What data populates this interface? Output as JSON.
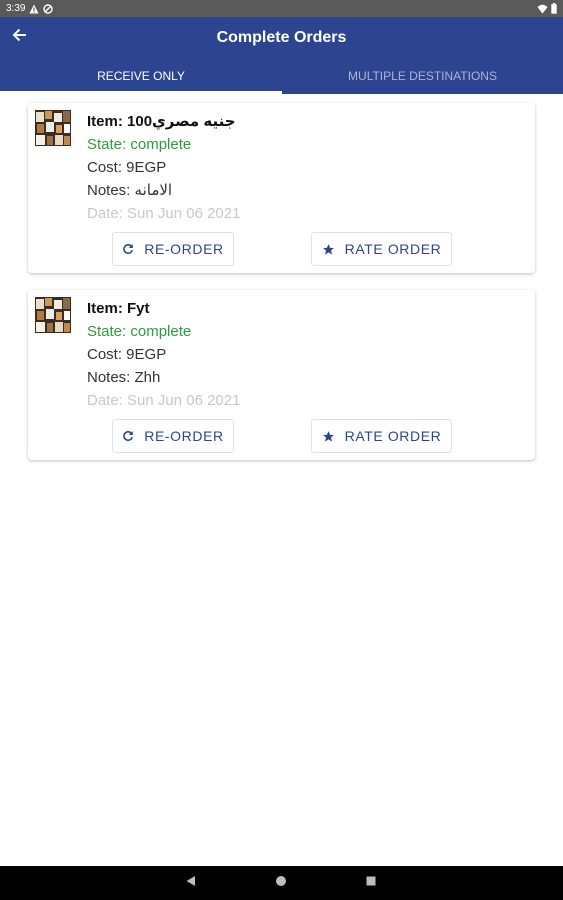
{
  "status_bar": {
    "time": "3:39",
    "icons": [
      "warning-icon",
      "circle-slash-icon",
      "wifi-icon",
      "battery-icon"
    ]
  },
  "app_bar": {
    "title": "Complete Orders",
    "back_icon": "arrow-back-icon"
  },
  "tabs": [
    {
      "label": "RECEIVE ONLY",
      "selected": true
    },
    {
      "label": "MULTIPLE DESTINATIONS",
      "selected": false
    }
  ],
  "colors": {
    "primary": "#2d4591",
    "state_complete": "#2e9c3a",
    "date_text": "#c8c8c8"
  },
  "orders": [
    {
      "item_label": "Item: 100جنيه مصري",
      "state_label": "State: complete",
      "cost_label": "Cost: 9EGP",
      "notes_label": "Notes: الامانه",
      "date_label": "Date: Sun Jun 06 2021",
      "reorder_label": "RE-ORDER",
      "rate_label": "RATE ORDER"
    },
    {
      "item_label": "Item: Fyt",
      "state_label": "State: complete",
      "cost_label": "Cost: 9EGP",
      "notes_label": "Notes: Zhh",
      "date_label": "Date: Sun Jun 06 2021",
      "reorder_label": "RE-ORDER",
      "rate_label": "RATE ORDER"
    }
  ],
  "nav_bar": {
    "icons": [
      "back-triangle-icon",
      "home-circle-icon",
      "recents-square-icon"
    ]
  }
}
